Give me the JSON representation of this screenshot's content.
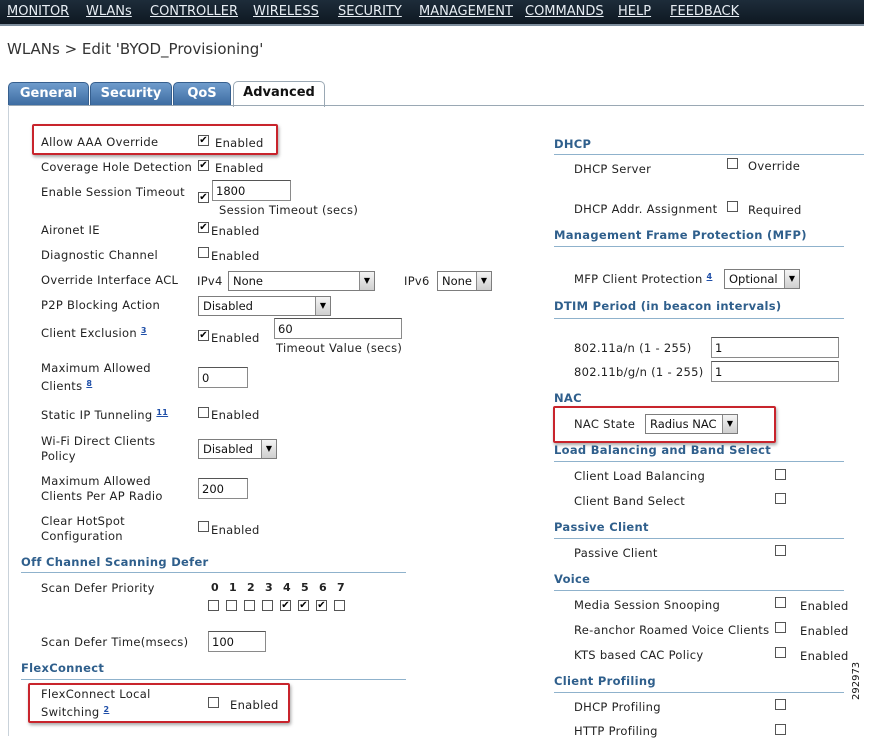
{
  "nav": {
    "monitor": "MONITOR",
    "wlans": "WLANs",
    "controller": "CONTROLLER",
    "wireless": "WIRELESS",
    "security": "SECURITY",
    "management": "MANAGEMENT",
    "commands": "COMMANDS",
    "help": "HELP",
    "feedback": "FEEDBACK"
  },
  "page_title": "WLANs > Edit  'BYOD_Provisioning'",
  "tabs": {
    "general": "General",
    "security": "Security",
    "qos": "QoS",
    "advanced": "Advanced",
    "active": "Advanced"
  },
  "left": {
    "aaa_override": {
      "label": "Allow AAA Override",
      "checked": true,
      "text": "Enabled"
    },
    "coverage_hole": {
      "label": "Coverage Hole Detection",
      "checked": true,
      "text": "Enabled"
    },
    "session_timeout": {
      "label": "Enable Session Timeout",
      "checked": true,
      "value": "1800",
      "caption": "Session Timeout (secs)"
    },
    "aironet_ie": {
      "label": "Aironet IE",
      "checked": true,
      "text": "Enabled"
    },
    "diag_channel": {
      "label": "Diagnostic Channel",
      "checked": false,
      "text": "Enabled"
    },
    "override_acl": {
      "label": "Override Interface ACL",
      "ipv4_label": "IPv4",
      "ipv4_value": "None",
      "ipv6_label": "IPv6",
      "ipv6_value": "None"
    },
    "p2p_blocking": {
      "label": "P2P Blocking Action",
      "value": "Disabled"
    },
    "client_exclusion": {
      "label": "Client Exclusion",
      "footnote": "3",
      "checked": true,
      "text": "Enabled",
      "value": "60",
      "caption": "Timeout Value (secs)"
    },
    "max_clients": {
      "label_line1": "Maximum Allowed",
      "label_line2": "Clients",
      "footnote": "8",
      "value": "0"
    },
    "static_ip": {
      "label": "Static IP Tunneling",
      "footnote": "11",
      "checked": false,
      "text": "Enabled"
    },
    "wifi_direct": {
      "label_line1": "Wi-Fi Direct Clients",
      "label_line2": "Policy",
      "value": "Disabled"
    },
    "max_clients_radio": {
      "label_line1": "Maximum Allowed",
      "label_line2": "Clients Per AP Radio",
      "value": "200"
    },
    "hotspot": {
      "label_line1": "Clear HotSpot",
      "label_line2": "Configuration",
      "checked": false,
      "text": "Enabled"
    },
    "off_channel_title": "Off Channel Scanning Defer",
    "scan_priority": {
      "label": "Scan Defer Priority",
      "digits": [
        "0",
        "1",
        "2",
        "3",
        "4",
        "5",
        "6",
        "7"
      ],
      "checked": [
        false,
        false,
        false,
        false,
        true,
        true,
        true,
        false
      ]
    },
    "scan_time": {
      "label": "Scan Defer Time(msecs)",
      "value": "100"
    },
    "flexconnect_title": "FlexConnect",
    "flex_local": {
      "label_line1": "FlexConnect Local",
      "label_line2": "Switching",
      "footnote": "2",
      "checked": false,
      "text": "Enabled"
    }
  },
  "right": {
    "dhcp_title": "DHCP",
    "dhcp_server": {
      "label": "DHCP Server",
      "checked": false,
      "text": "Override"
    },
    "dhcp_addr": {
      "label": "DHCP Addr. Assignment",
      "checked": false,
      "text": "Required"
    },
    "mfp_title": "Management Frame Protection (MFP)",
    "mfp": {
      "label": "MFP Client Protection",
      "footnote": "4",
      "value": "Optional"
    },
    "dtim_title": "DTIM Period (in beacon intervals)",
    "dtim_an": {
      "label": "802.11a/n (1 - 255)",
      "value": "1"
    },
    "dtim_bgn": {
      "label": "802.11b/g/n (1 - 255)",
      "value": "1"
    },
    "nac_title": "NAC",
    "nac_state": {
      "label": "NAC State",
      "value": "Radius NAC"
    },
    "lb_title": "Load Balancing and Band Select",
    "client_lb": {
      "label": "Client Load Balancing",
      "checked": false
    },
    "client_band": {
      "label": "Client Band Select",
      "checked": false
    },
    "passive_title": "Passive Client",
    "passive": {
      "label": "Passive Client",
      "checked": false
    },
    "voice_title": "Voice",
    "media_snoop": {
      "label": "Media Session Snooping",
      "checked": false,
      "text": "Enabled"
    },
    "reanchor": {
      "label": "Re-anchor Roamed Voice Clients",
      "checked": false,
      "text": "Enabled"
    },
    "kts": {
      "label": "KTS based CAC Policy",
      "checked": false,
      "text": "Enabled"
    },
    "profiling_title": "Client Profiling",
    "dhcp_profiling": {
      "label": "DHCP Profiling",
      "checked": false
    },
    "http_profiling": {
      "label": "HTTP Profiling",
      "checked": false
    }
  },
  "figure_id": "292973",
  "colors": {
    "nav_bg": "#14212d",
    "tab_blue": "#4d7db3",
    "section_text": "#2f5f8c",
    "highlight_red": "#c8242c"
  }
}
